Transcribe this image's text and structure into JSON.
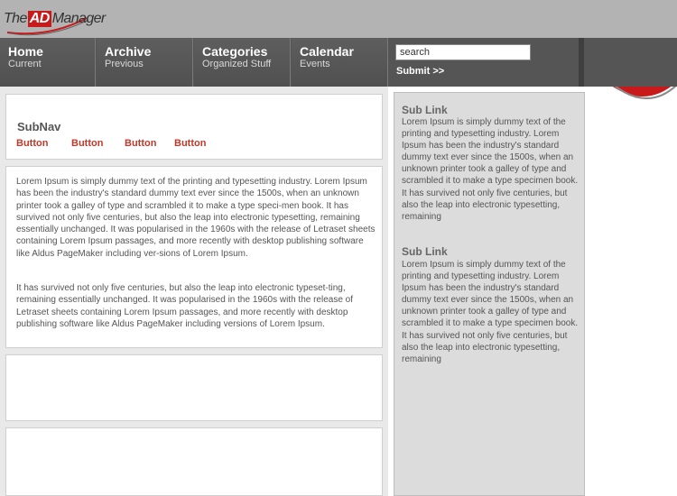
{
  "logo": {
    "prefix": "The",
    "highlight": "AD",
    "suffix": "Manager"
  },
  "nav": {
    "items": [
      {
        "title": "Home",
        "subtitle": "Current"
      },
      {
        "title": "Archive",
        "subtitle": "Previous"
      },
      {
        "title": "Categories",
        "subtitle": "Organized Stuff"
      },
      {
        "title": "Calendar",
        "subtitle": "Events"
      }
    ],
    "search_value": "search",
    "submit_label": "Submit >>"
  },
  "subnav": {
    "title": "SubNav",
    "buttons": [
      "Button",
      "Button",
      "Button",
      "Button"
    ]
  },
  "content": {
    "paragraphs": [
      "Lorem Ipsum is simply dummy text of the printing and typesetting industry. Lorem Ipsum has been the industry's standard dummy text ever since the 1500s, when an unknown printer took a galley of type and scrambled it to make a type speci-men book. It has survived not only five centuries, but also the leap into electronic typesetting, remaining essentially unchanged. It was popularised in the 1960s with the release of Letraset sheets containing Lorem Ipsum passages, and more recently with desktop publishing software like Aldus PageMaker including ver-sions of Lorem Ipsum.",
      "It has survived not only five centuries, but also the leap into electronic typeset-ting, remaining essentially unchanged. It was popularised in the 1960s with the release of Letraset sheets containing Lorem Ipsum passages, and more recently with desktop publishing software like Aldus PageMaker including versions of Lorem Ipsum."
    ]
  },
  "sidebar": {
    "sections": [
      {
        "title": "Sub Link",
        "text": "Lorem Ipsum is simply dummy text of the printing and typesetting industry. Lorem Ipsum has been the industry's standard dummy text ever since the 1500s, when an unknown printer took a galley of type and scrambled it to make a type specimen book. It has survived not only five centuries, but also the leap into electronic typesetting, remaining"
      },
      {
        "title": "Sub Link",
        "text": "Lorem Ipsum is simply dummy text of the printing and typesetting industry. Lorem Ipsum has been the industry's standard dummy text ever since the 1500s, when an unknown printer took a galley of type and scrambled it to make a type specimen book. It has survived not only five centuries, but also the leap into electronic typesetting, remaining"
      }
    ]
  },
  "colors": {
    "accent_red": "#c8191b",
    "nav_bg": "#555555",
    "header_bg": "#b3b3b3",
    "sidebar_bg": "#dcdcdc"
  }
}
